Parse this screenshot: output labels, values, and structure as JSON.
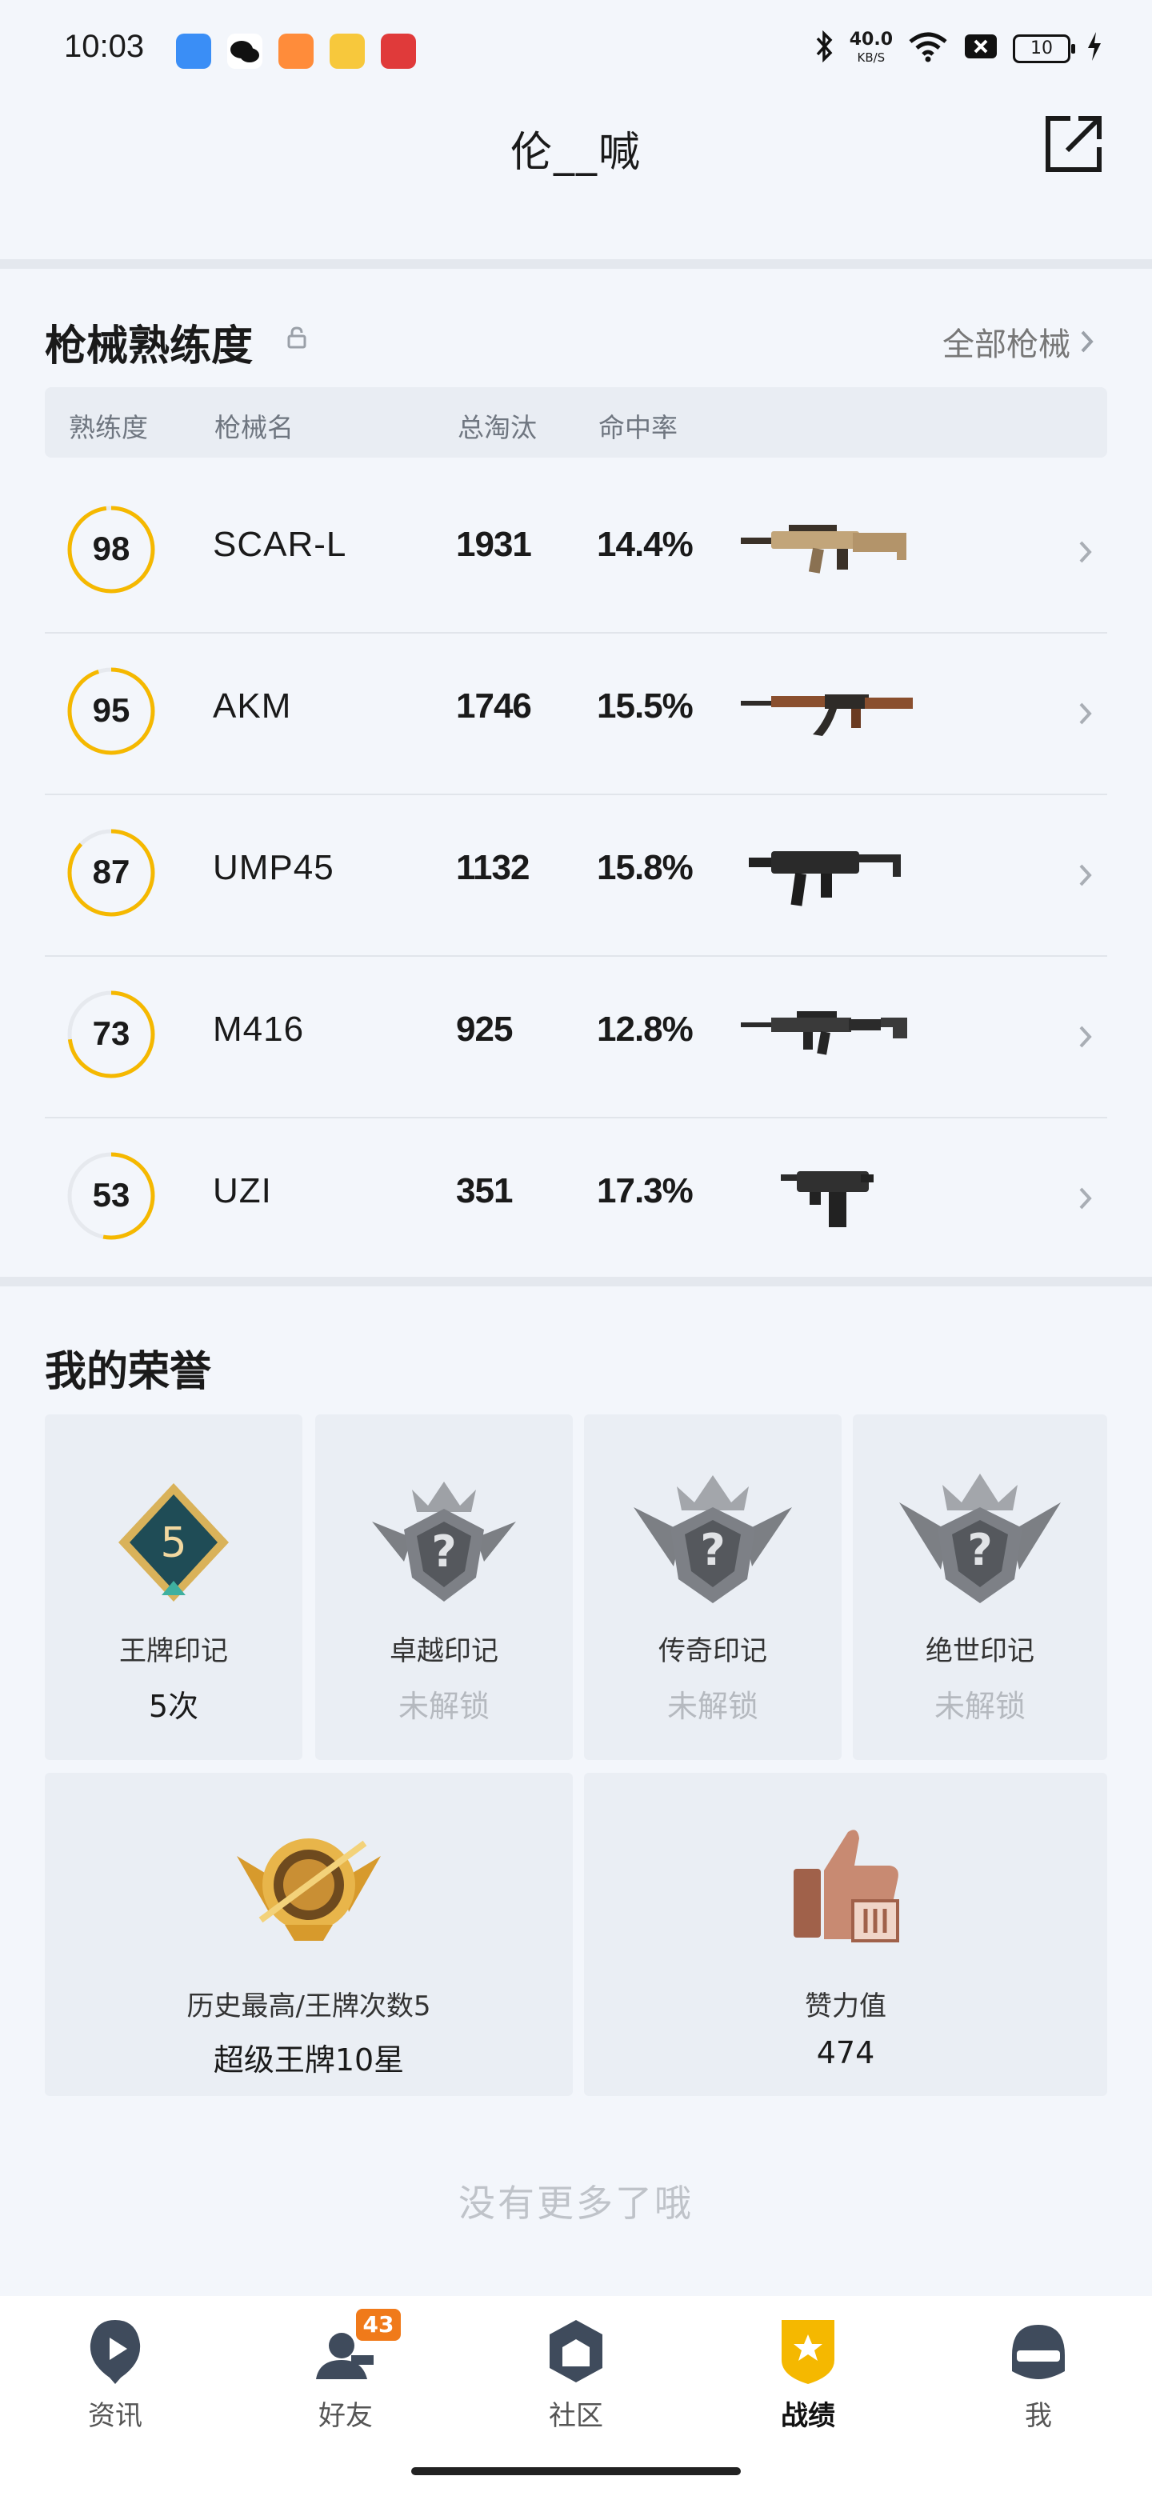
{
  "status_bar": {
    "time": "10:03",
    "speed_value": "40.0",
    "speed_unit": "KB/S",
    "battery": "10"
  },
  "header": {
    "title": "伦__喊"
  },
  "weapons": {
    "title": "枪械熟练度",
    "all_link": "全部枪械",
    "columns": [
      "熟练度",
      "枪械名",
      "总淘汰",
      "命中率"
    ],
    "rows": [
      {
        "proficiency": "98",
        "proficiency_value": 98,
        "name": "SCAR-L",
        "kills": "1931",
        "hit_rate": "14.4%"
      },
      {
        "proficiency": "95",
        "proficiency_value": 95,
        "name": "AKM",
        "kills": "1746",
        "hit_rate": "15.5%"
      },
      {
        "proficiency": "87",
        "proficiency_value": 87,
        "name": "UMP45",
        "kills": "1132",
        "hit_rate": "15.8%"
      },
      {
        "proficiency": "73",
        "proficiency_value": 73,
        "name": "M416",
        "kills": "925",
        "hit_rate": "12.8%"
      },
      {
        "proficiency": "53",
        "proficiency_value": 53,
        "name": "UZI",
        "kills": "351",
        "hit_rate": "17.3%"
      }
    ]
  },
  "honors": {
    "title": "我的荣誉",
    "badges": [
      {
        "name": "王牌印记",
        "value": "5次",
        "locked": false,
        "badge_number": "5"
      },
      {
        "name": "卓越印记",
        "value": "未解锁",
        "locked": true
      },
      {
        "name": "传奇印记",
        "value": "未解锁",
        "locked": true
      },
      {
        "name": "绝世印记",
        "value": "未解锁",
        "locked": true
      }
    ],
    "highest": {
      "label": "历史最高/王牌次数5",
      "value": "超级王牌10星"
    },
    "likes": {
      "label": "赞力值",
      "value": "474"
    }
  },
  "footer_note": "没有更多了哦",
  "bottom_nav": {
    "items": [
      {
        "label": "资讯",
        "icon": "news-icon",
        "active": false
      },
      {
        "label": "好友",
        "icon": "friends-icon",
        "active": false,
        "badge": "43"
      },
      {
        "label": "社区",
        "icon": "community-icon",
        "active": false
      },
      {
        "label": "战绩",
        "icon": "record-icon",
        "active": true
      },
      {
        "label": "我",
        "icon": "me-icon",
        "active": false
      }
    ]
  },
  "colors": {
    "accent": "#f5b800",
    "ring_track": "#e6e9ee",
    "background": "#f3f6fb",
    "badge": "#f07a1a"
  }
}
